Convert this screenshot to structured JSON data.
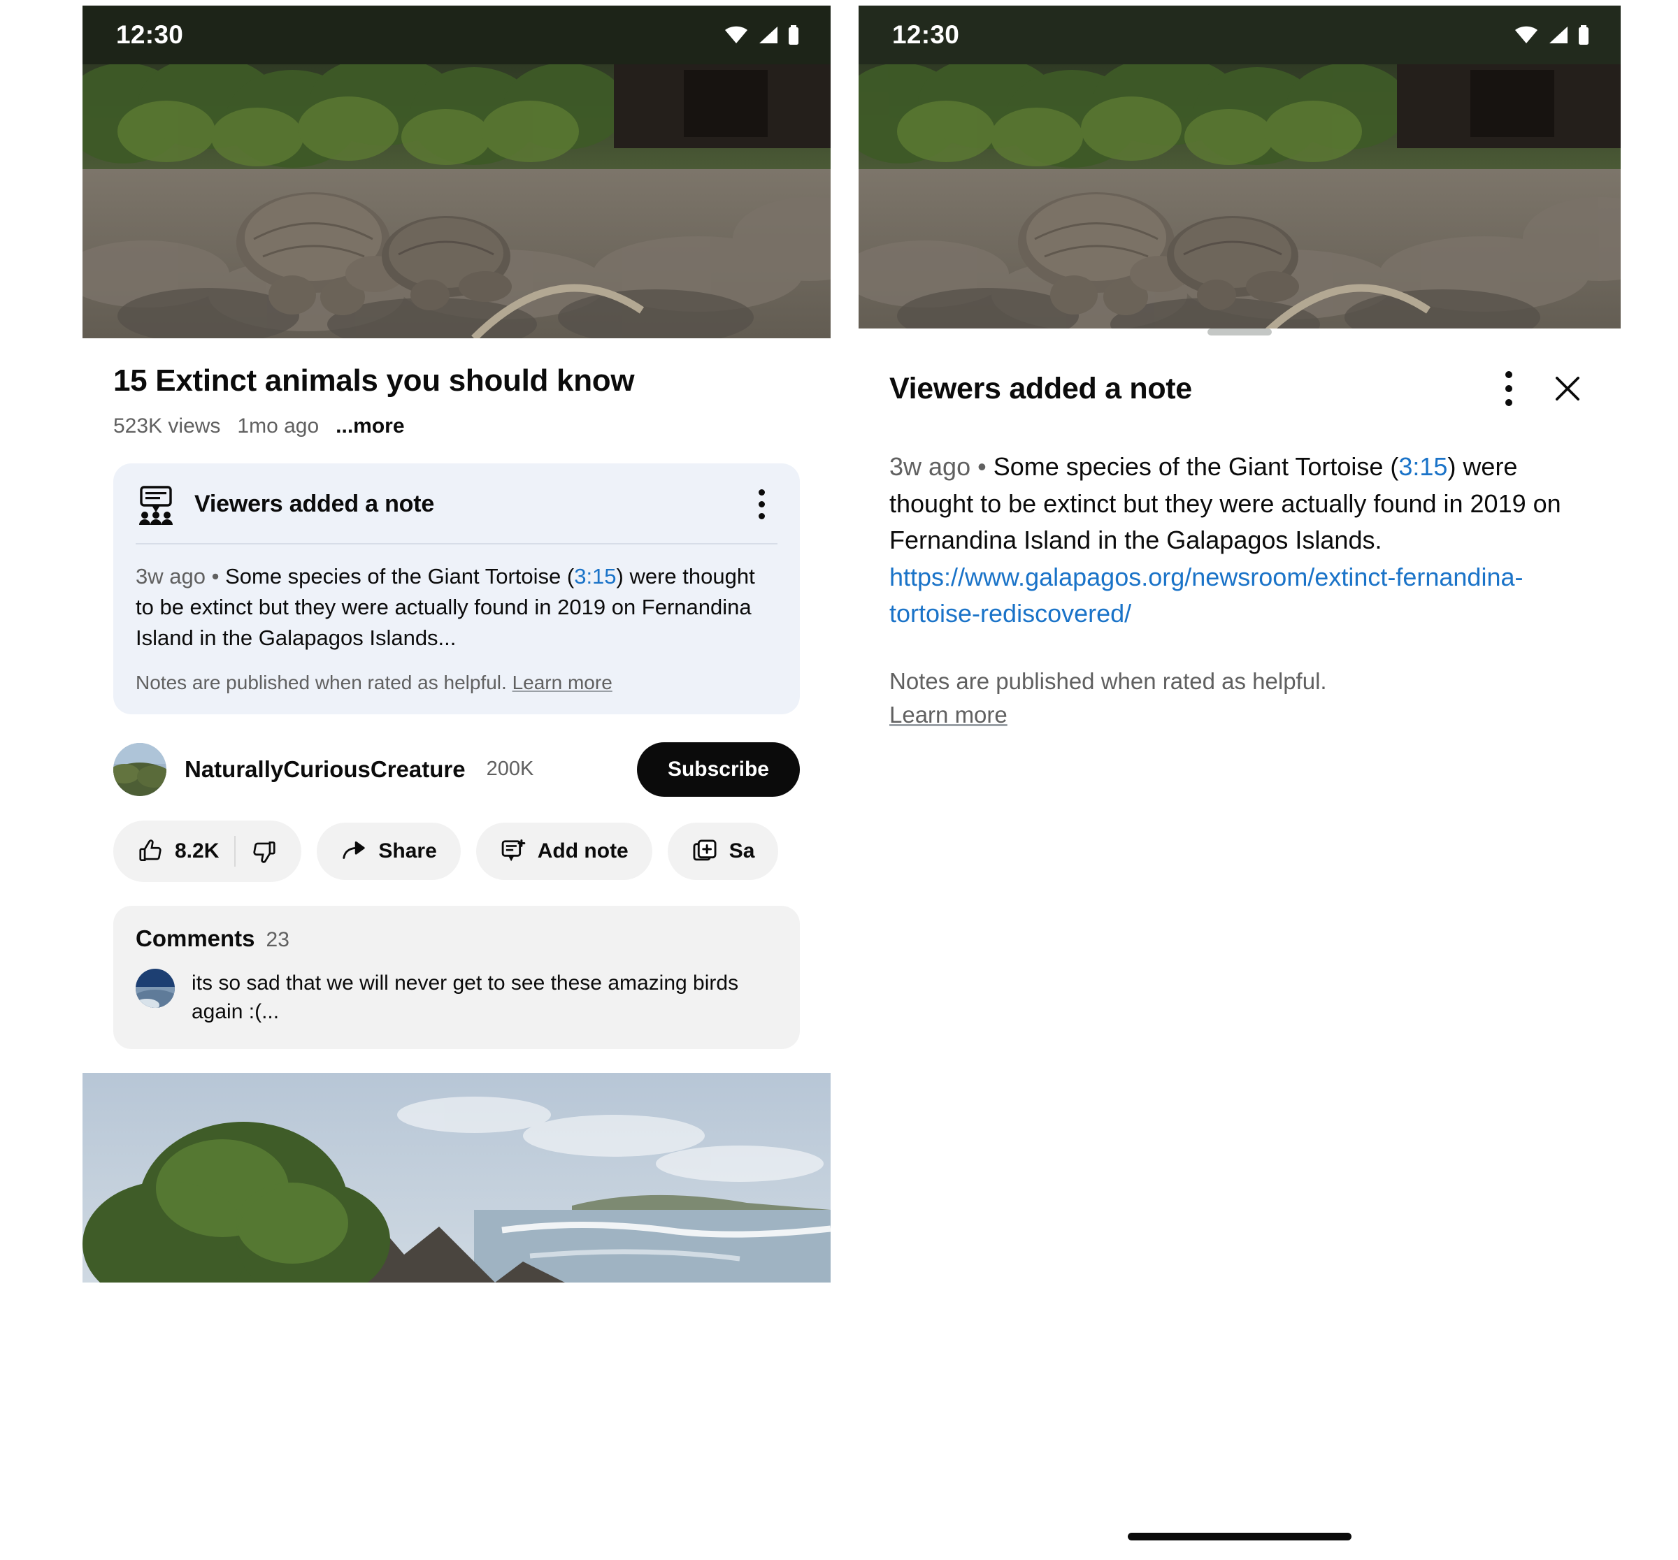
{
  "status_bar": {
    "time": "12:30",
    "icons": [
      "wifi-icon",
      "cellular-signal-icon",
      "battery-icon"
    ]
  },
  "left_panel": {
    "video": {
      "title": "15 Extinct animals you should know",
      "views": "523K views",
      "age": "1mo ago",
      "more_label": "...more"
    },
    "note_card": {
      "icon": "viewers-note-icon",
      "title": "Viewers added a note",
      "menu_icon": "overflow-menu-icon",
      "timestamp": "3w ago",
      "separator": "•",
      "body_before_link": "Some species of the Giant Tortoise (",
      "video_timestamp_link": "3:15",
      "body_after_link": ") were thought to be extinct but they were actually found in 2019 on Fernandina Island in the Galapagos Islands...",
      "footer_text": "Notes are published when rated as helpful.",
      "footer_link": "Learn more"
    },
    "channel": {
      "avatar": "channel-avatar",
      "name": "NaturallyCuriousCreature",
      "subscribers": "200K",
      "subscribe_label": "Subscribe"
    },
    "actions": [
      {
        "name": "like-button",
        "icon": "thumbs-up-icon",
        "label": "8.2K"
      },
      {
        "name": "dislike-button",
        "icon": "thumbs-down-icon",
        "label": ""
      },
      {
        "name": "share-button",
        "icon": "share-icon",
        "label": "Share"
      },
      {
        "name": "add-note-button",
        "icon": "add-note-icon",
        "label": "Add note"
      },
      {
        "name": "save-button",
        "icon": "save-icon",
        "label": "Sa"
      }
    ],
    "comments": {
      "title": "Comments",
      "count": "23",
      "first_comment": {
        "avatar": "commenter-avatar",
        "text": "its so sad that we will never get to see these amazing birds again :(..."
      }
    }
  },
  "right_panel": {
    "sheet": {
      "grabber": "drag-handle",
      "title": "Viewers added a note",
      "menu_icon": "overflow-menu-icon",
      "close_icon": "close-icon",
      "timestamp": "3w ago",
      "separator": "•",
      "body_before_ts_link": "Some species of the Giant Tortoise (",
      "video_timestamp_link": "3:15",
      "body_middle": ") were thought to be extinct but they were actually found in 2019 on Fernandina Island in the Galapagos Islands. ",
      "url": "https://www.galapagos.org/newsroom/extinct-fernandina-tortoise-rediscovered/",
      "footer_text": "Notes are published when rated as helpful.",
      "footer_link": "Learn more"
    },
    "gesture_bar": "home-indicator"
  },
  "colors": {
    "link_blue": "#1a73c8",
    "note_card_bg": "#eef2f9",
    "pill_bg": "#f2f2f2",
    "subscribe_bg": "#0b0b0b",
    "status_bar_bg": "#1d2418",
    "secondary_text": "#606060"
  }
}
